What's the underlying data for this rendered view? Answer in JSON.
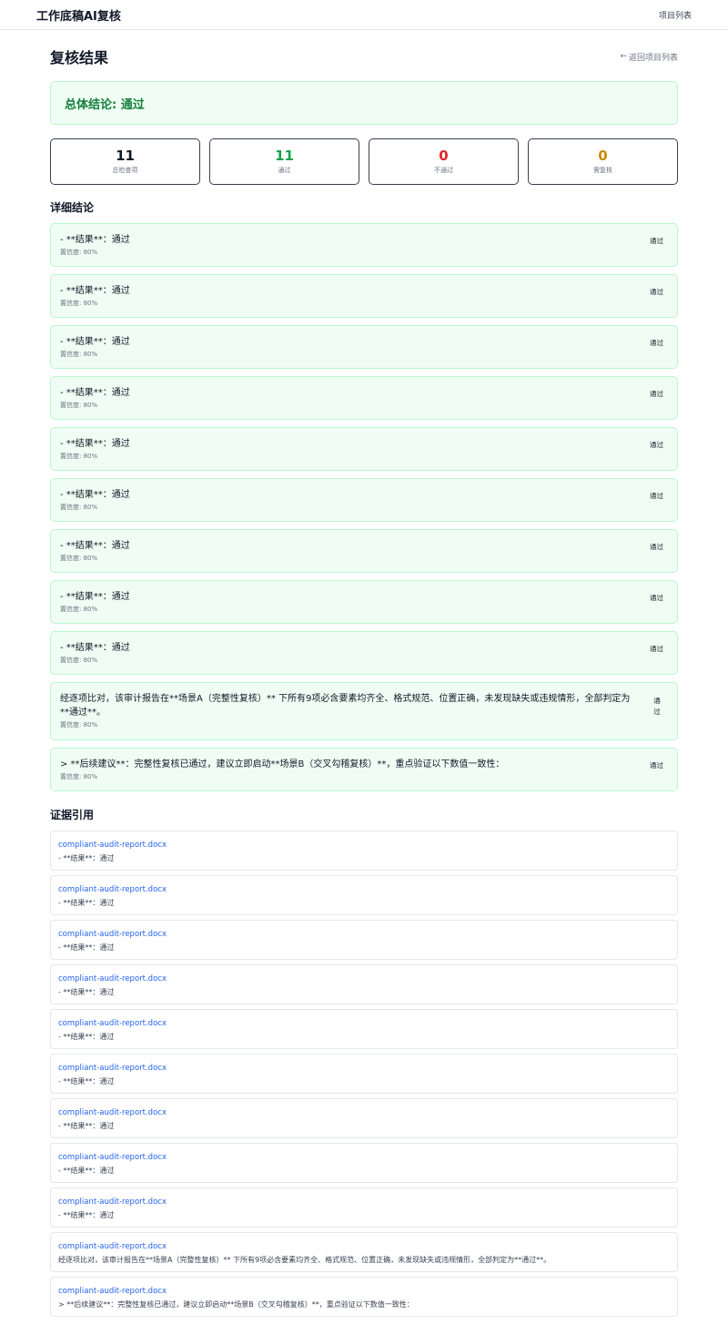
{
  "header": {
    "app_title": "工作底稿AI复核",
    "nav_projects": "项目列表"
  },
  "page": {
    "title": "复核结果",
    "back_label": "返回项目列表"
  },
  "overall": {
    "text": "总体结论: 通过"
  },
  "stats": [
    {
      "value": "11",
      "label": "总检查项",
      "color": "#111827"
    },
    {
      "value": "11",
      "label": "通过",
      "color": "#16a34a"
    },
    {
      "value": "0",
      "label": "不通过",
      "color": "#dc2626"
    },
    {
      "value": "0",
      "label": "需复核",
      "color": "#ca8a04"
    }
  ],
  "details": {
    "title": "详细结论",
    "items": [
      {
        "text": "- **结果**：通过",
        "confidence": "置信度: 80%",
        "status": "通过"
      },
      {
        "text": "- **结果**：通过",
        "confidence": "置信度: 80%",
        "status": "通过"
      },
      {
        "text": "- **结果**：通过",
        "confidence": "置信度: 80%",
        "status": "通过"
      },
      {
        "text": "- **结果**：通过",
        "confidence": "置信度: 80%",
        "status": "通过"
      },
      {
        "text": "- **结果**：通过",
        "confidence": "置信度: 80%",
        "status": "通过"
      },
      {
        "text": "- **结果**：通过",
        "confidence": "置信度: 80%",
        "status": "通过"
      },
      {
        "text": "- **结果**：通过",
        "confidence": "置信度: 80%",
        "status": "通过"
      },
      {
        "text": "- **结果**：通过",
        "confidence": "置信度: 80%",
        "status": "通过"
      },
      {
        "text": "- **结果**：通过",
        "confidence": "置信度: 80%",
        "status": "通过"
      },
      {
        "text": "经逐项比对，该审计报告在**场景A（完整性复核）** 下所有9项必含要素均齐全、格式规范、位置正确，未发现缺失或违规情形，全部判定为**通过**。",
        "confidence": "置信度: 80%",
        "status": "通过"
      },
      {
        "text": "> **后续建议**：完整性复核已通过，建议立即启动**场景B（交叉勾稽复核）**，重点验证以下数值一致性：",
        "confidence": "置信度: 80%",
        "status": "通过"
      }
    ]
  },
  "evidence": {
    "title": "证据引用",
    "items": [
      {
        "file": "compliant-audit-report.docx",
        "text": "- **结果**：通过"
      },
      {
        "file": "compliant-audit-report.docx",
        "text": "- **结果**：通过"
      },
      {
        "file": "compliant-audit-report.docx",
        "text": "- **结果**：通过"
      },
      {
        "file": "compliant-audit-report.docx",
        "text": "- **结果**：通过"
      },
      {
        "file": "compliant-audit-report.docx",
        "text": "- **结果**：通过"
      },
      {
        "file": "compliant-audit-report.docx",
        "text": "- **结果**：通过"
      },
      {
        "file": "compliant-audit-report.docx",
        "text": "- **结果**：通过"
      },
      {
        "file": "compliant-audit-report.docx",
        "text": "- **结果**：通过"
      },
      {
        "file": "compliant-audit-report.docx",
        "text": "- **结果**：通过"
      },
      {
        "file": "compliant-audit-report.docx",
        "text": "经逐项比对，该审计报告在**场景A（完整性复核）** 下所有9项必含要素均齐全、格式规范、位置正确，未发现缺失或违规情形，全部判定为**通过**。"
      },
      {
        "file": "compliant-audit-report.docx",
        "text": "> **后续建议**：完整性复核已通过，建议立即启动**场景B（交叉勾稽复核）**，重点验证以下数值一致性："
      }
    ]
  }
}
